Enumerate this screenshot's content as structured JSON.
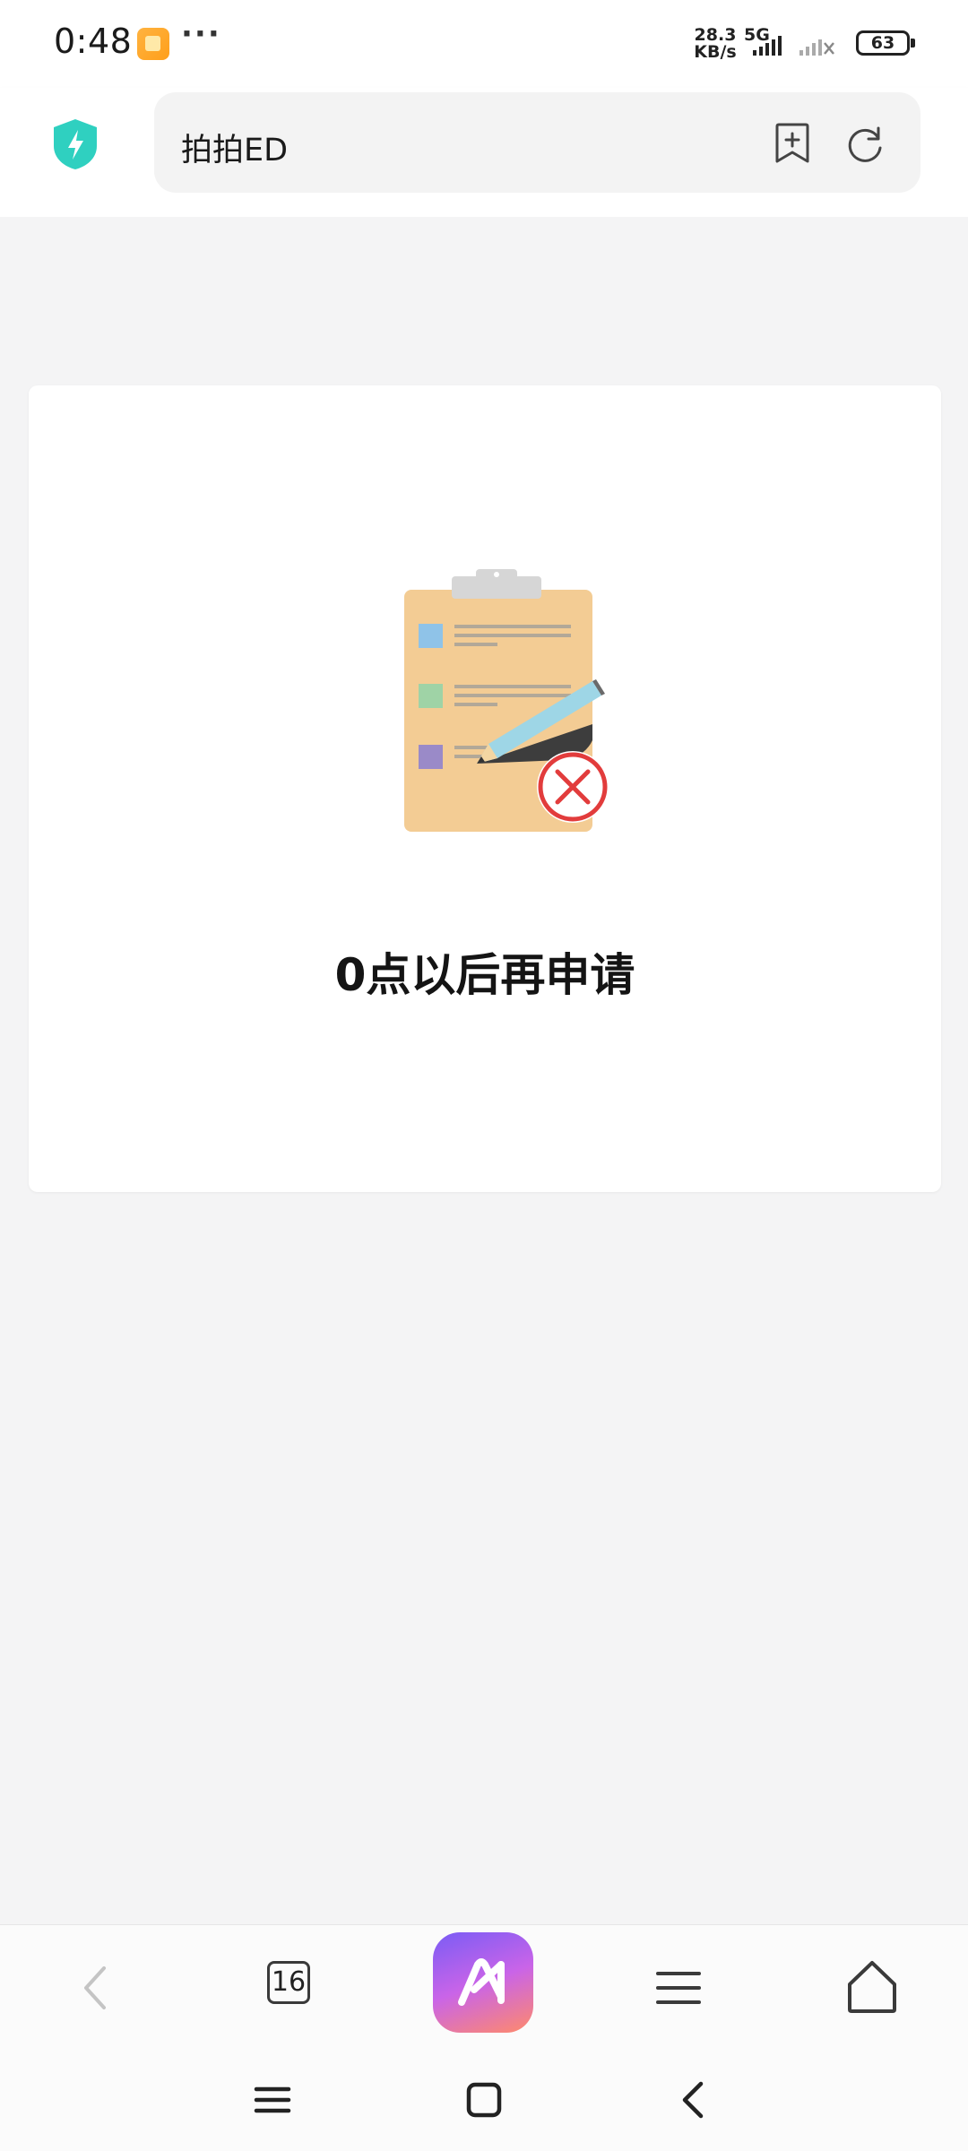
{
  "status_bar": {
    "time": "0:48",
    "more": "···",
    "speed_value": "28.3",
    "speed_unit": "KB/s",
    "network_type": "5G",
    "battery_level": "63"
  },
  "address_bar": {
    "url_text": "拍拍ED"
  },
  "main": {
    "message": "0点以后再申请"
  },
  "toolbar": {
    "tab_count": "16"
  },
  "colors": {
    "accent_shield": "#2fd0c0",
    "error_red": "#e23c3c",
    "clipboard": "#f3cc94"
  }
}
